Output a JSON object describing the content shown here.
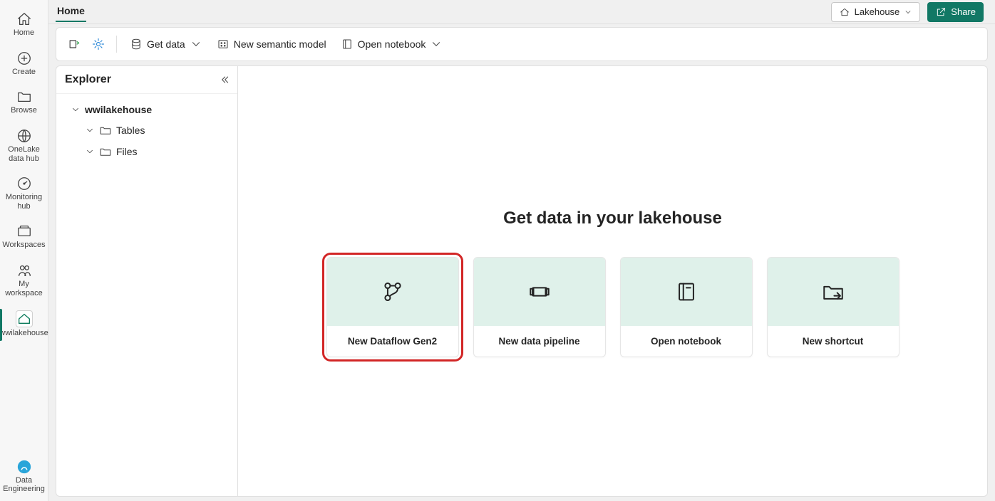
{
  "leftRail": {
    "home": "Home",
    "create": "Create",
    "browse": "Browse",
    "onelake": "OneLake data hub",
    "monitoring": "Monitoring hub",
    "workspaces": "Workspaces",
    "myworkspace": "My workspace",
    "wwilakehouse": "wwilakehouse",
    "dataengineering": "Data Engineering"
  },
  "header": {
    "title": "Home",
    "lakehouseBtn": "Lakehouse",
    "shareBtn": "Share"
  },
  "toolbar": {
    "getData": "Get data",
    "newSemanticModel": "New semantic model",
    "openNotebook": "Open notebook"
  },
  "explorer": {
    "title": "Explorer",
    "root": "wwilakehouse",
    "tables": "Tables",
    "files": "Files"
  },
  "canvas": {
    "title": "Get data in your lakehouse",
    "cards": [
      {
        "label": "New Dataflow Gen2",
        "highlight": true
      },
      {
        "label": "New data pipeline",
        "highlight": false
      },
      {
        "label": "Open notebook",
        "highlight": false
      },
      {
        "label": "New shortcut",
        "highlight": false
      }
    ]
  }
}
